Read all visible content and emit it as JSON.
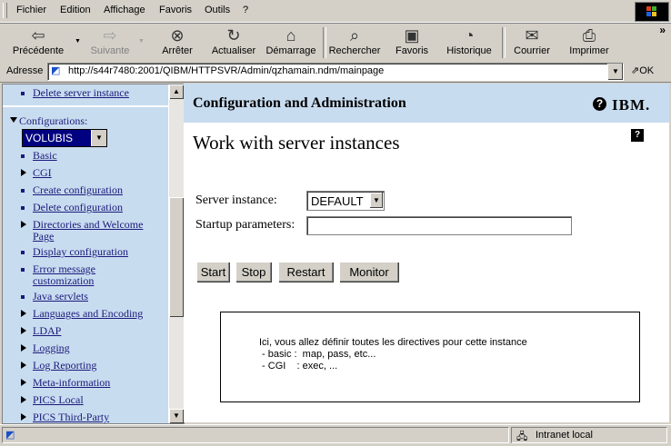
{
  "menubar": {
    "items": [
      "Fichier",
      "Edition",
      "Affichage",
      "Favoris",
      "Outils",
      "?"
    ]
  },
  "toolbar": {
    "buttons": [
      {
        "label": "Précédente",
        "icon": "back-arrow-icon",
        "enabled": true
      },
      {
        "label": "Suivante",
        "icon": "forward-arrow-icon",
        "enabled": false
      },
      {
        "label": "Arrêter",
        "icon": "stop-icon",
        "enabled": true
      },
      {
        "label": "Actualiser",
        "icon": "refresh-icon",
        "enabled": true
      },
      {
        "label": "Démarrage",
        "icon": "home-icon",
        "enabled": true
      },
      {
        "label": "Rechercher",
        "icon": "search-icon",
        "enabled": true
      },
      {
        "label": "Favoris",
        "icon": "favorites-icon",
        "enabled": true
      },
      {
        "label": "Historique",
        "icon": "history-icon",
        "enabled": true
      },
      {
        "label": "Courrier",
        "icon": "mail-icon",
        "enabled": true
      },
      {
        "label": "Imprimer",
        "icon": "printer-icon",
        "enabled": true
      }
    ],
    "more": "»"
  },
  "address": {
    "label": "Adresse",
    "url": "http://s44r7480:2001/QIBM/HTTPSVR/Admin/qzhamain.ndm/mainpage",
    "go_label": "OK"
  },
  "nav": {
    "top_link": "Delete server instance",
    "configurations_label": "Configurations:",
    "config_selected": "VOLUBIS",
    "items": [
      {
        "label": "Basic",
        "type": "bullet"
      },
      {
        "label": "CGI",
        "type": "expand"
      },
      {
        "label": "Create configuration",
        "type": "bullet"
      },
      {
        "label": "Delete configuration",
        "type": "bullet"
      },
      {
        "label": "Directories and Welcome",
        "label2": "Page",
        "type": "expand"
      },
      {
        "label": "Display configuration",
        "type": "bullet"
      },
      {
        "label": "Error message",
        "label2": "customization",
        "type": "bullet"
      },
      {
        "label": "Java servlets",
        "type": "bullet"
      },
      {
        "label": "Languages and Encoding",
        "type": "expand"
      },
      {
        "label": "LDAP",
        "type": "expand"
      },
      {
        "label": "Logging",
        "type": "expand"
      },
      {
        "label": "Log Reporting",
        "type": "expand"
      },
      {
        "label": "Meta-information",
        "type": "expand"
      },
      {
        "label": "PICS Local",
        "type": "expand"
      },
      {
        "label": "PICS Third-Party",
        "type": "expand"
      }
    ]
  },
  "main": {
    "header_title": "Configuration and Administration",
    "help_glyph": "?",
    "logo_text": "IBM.",
    "page_title": "Work with server instances",
    "page_help_glyph": "?",
    "server_instance_label": "Server instance:",
    "server_instance_value": "DEFAULT",
    "startup_label": "Startup parameters:",
    "startup_value": "",
    "buttons": [
      "Start",
      "Stop",
      "Restart",
      "Monitor"
    ],
    "info_lines": [
      "Ici, vous allez définir toutes les directives pour cette instance",
      " - basic :  map, pass, etc...",
      " - CGI    : exec, ..."
    ]
  },
  "status": {
    "text": "",
    "zone": "Intranet local"
  }
}
